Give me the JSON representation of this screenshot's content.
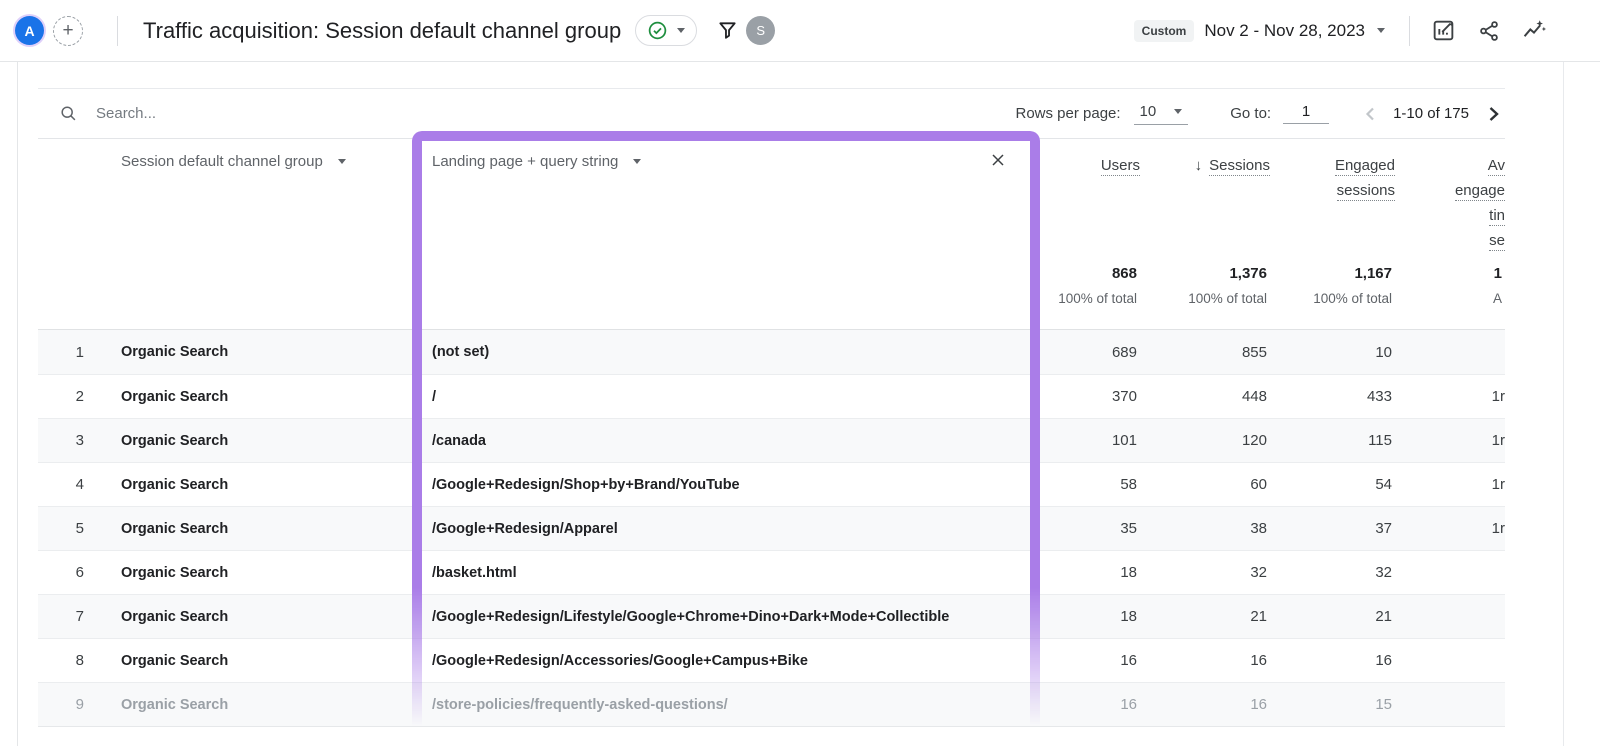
{
  "header": {
    "avatar_a": "A",
    "avatar_s": "S",
    "title": "Traffic acquisition: Session default channel group",
    "date_preset": "Custom",
    "date_range": "Nov 2 - Nov 28, 2023"
  },
  "toolbar": {
    "search_placeholder": "Search...",
    "rows_per_page_label": "Rows per page:",
    "rows_per_page_value": "10",
    "goto_label": "Go to:",
    "goto_value": "1",
    "page_range": "1-10 of 175"
  },
  "table": {
    "col_channel": "Session default channel group",
    "col_landing": "Landing page + query string",
    "col_users": "Users",
    "col_sessions": "Sessions",
    "col_engaged_1": "Engaged",
    "col_engaged_2": "sessions",
    "col_avg_lines": [
      "Av",
      "engage",
      "tin",
      "se"
    ],
    "totals": {
      "users": "868",
      "users_sub": "100% of total",
      "sessions": "1,376",
      "sessions_sub": "100% of total",
      "engaged": "1,167",
      "engaged_sub": "100% of total",
      "avg": "1",
      "avg_sub": "A"
    },
    "rows": [
      {
        "num": "1",
        "channel": "Organic Search",
        "landing": "(not set)",
        "users": "689",
        "sessions": "855",
        "engaged": "10",
        "avg": ""
      },
      {
        "num": "2",
        "channel": "Organic Search",
        "landing": "/",
        "users": "370",
        "sessions": "448",
        "engaged": "433",
        "avg": "1r"
      },
      {
        "num": "3",
        "channel": "Organic Search",
        "landing": "/canada",
        "users": "101",
        "sessions": "120",
        "engaged": "115",
        "avg": "1r"
      },
      {
        "num": "4",
        "channel": "Organic Search",
        "landing": "/Google+Redesign/Shop+by+Brand/YouTube",
        "users": "58",
        "sessions": "60",
        "engaged": "54",
        "avg": "1r"
      },
      {
        "num": "5",
        "channel": "Organic Search",
        "landing": "/Google+Redesign/Apparel",
        "users": "35",
        "sessions": "38",
        "engaged": "37",
        "avg": "1r"
      },
      {
        "num": "6",
        "channel": "Organic Search",
        "landing": "/basket.html",
        "users": "18",
        "sessions": "32",
        "engaged": "32",
        "avg": ""
      },
      {
        "num": "7",
        "channel": "Organic Search",
        "landing": "/Google+Redesign/Lifestyle/Google+Chrome+Dino+Dark+Mode+Collectible",
        "users": "18",
        "sessions": "21",
        "engaged": "21",
        "avg": ""
      },
      {
        "num": "8",
        "channel": "Organic Search",
        "landing": "/Google+Redesign/Accessories/Google+Campus+Bike",
        "users": "16",
        "sessions": "16",
        "engaged": "16",
        "avg": ""
      },
      {
        "num": "9",
        "channel": "Organic Search",
        "landing": "/store-policies/frequently-asked-questions/",
        "users": "16",
        "sessions": "16",
        "engaged": "15",
        "avg": ""
      }
    ]
  },
  "icons": {
    "plus": "+",
    "sort_desc": "↓"
  },
  "colors": {
    "highlight_purple": "#aa7de8",
    "avatar_blue": "#1a73e8",
    "check_green": "#1e8e3e"
  }
}
